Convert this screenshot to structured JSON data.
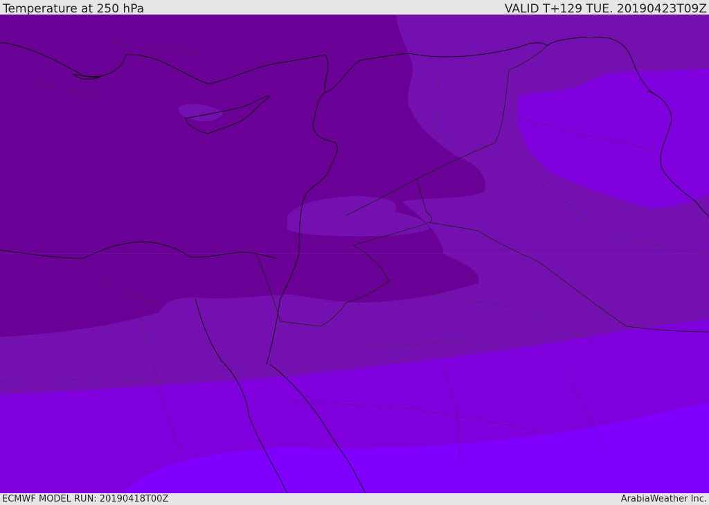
{
  "header": {
    "title": "Temperature at 250 hPa",
    "valid_time": "VALID T+129 TUE. 20190423T09Z"
  },
  "footer": {
    "model_run": "ECMWF MODEL RUN: 20190418T00Z",
    "credit": "ArabiaWeather Inc."
  },
  "colors": {
    "band_darkest": "#6a0096",
    "band_dark": "#7510b0",
    "band_mid": "#8000dd",
    "band_light": "#7f00ff",
    "coastline": "#111111",
    "border": "#222222"
  }
}
